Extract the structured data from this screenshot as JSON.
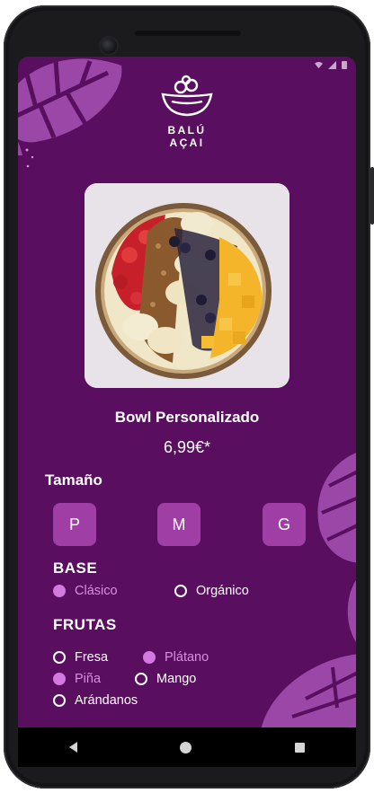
{
  "app": {
    "brand": "BALÚ AÇAI"
  },
  "product": {
    "name": "Bowl Personalizado",
    "price": "6,99€*"
  },
  "size": {
    "label": "Tamaño",
    "options": [
      "P",
      "M",
      "G"
    ]
  },
  "base": {
    "label": "BASE",
    "options": [
      {
        "label": "Clásico",
        "selected": true
      },
      {
        "label": "Orgánico",
        "selected": false
      }
    ]
  },
  "fruits": {
    "label": "FRUTAS",
    "options": [
      {
        "label": "Fresa",
        "selected": false
      },
      {
        "label": "Plátano",
        "selected": true
      },
      {
        "label": "Piña",
        "selected": true
      },
      {
        "label": "Mango",
        "selected": false
      },
      {
        "label": "Arándanos",
        "selected": false
      }
    ]
  },
  "colors": {
    "background": "#5a0e5f",
    "button": "#9f3fa6",
    "selected": "#d27ae0",
    "leaf": "#9a47a8"
  },
  "icons": {
    "logo": "acai-bowl-icon",
    "nav_back": "back-triangle-icon",
    "nav_home": "home-circle-icon",
    "nav_recents": "recents-square-icon"
  }
}
